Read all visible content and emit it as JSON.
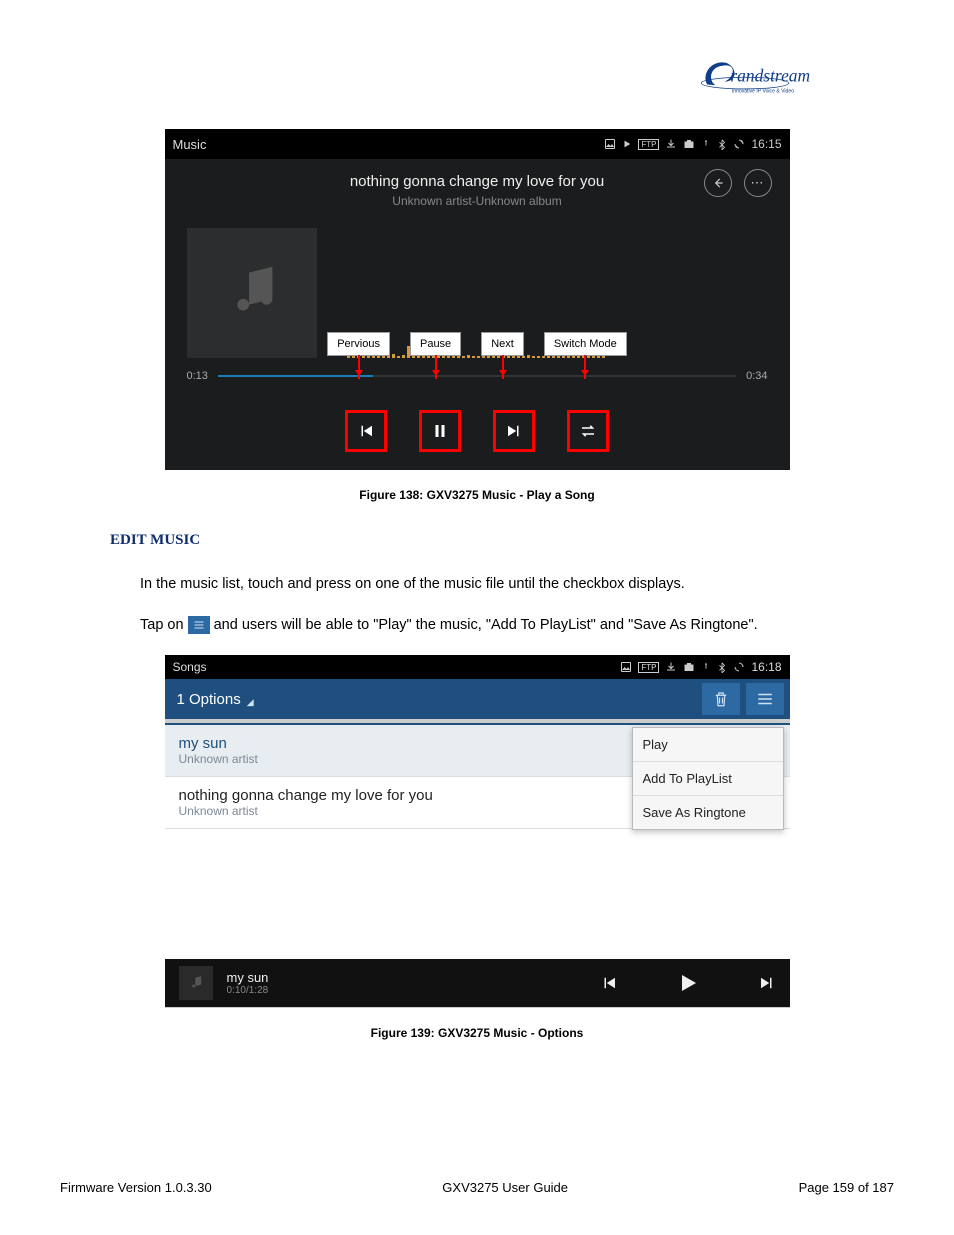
{
  "logo": {
    "brand": "Grandstream",
    "tagline": "Innovative IP Voice & Video"
  },
  "screenshot1": {
    "status": {
      "title": "Music",
      "time": "16:15"
    },
    "song": "nothing gonna change my love for you",
    "artist_album": "Unknown artist-Unknown album",
    "elapsed": "0:13",
    "total": "0:34",
    "labels": {
      "prev": "Pervious",
      "pause": "Pause",
      "next": "Next",
      "mode": "Switch Mode"
    }
  },
  "caption1": "Figure 138: GXV3275 Music - Play a Song",
  "section_heading": "EDIT MUSIC",
  "para1": "In the music list, touch and press on one of the music file until the checkbox displays.",
  "para2_pre": "Tap on ",
  "para2_post": " and users will be able to \"Play\" the music, \"Add To PlayList\" and \"Save As Ringtone\".",
  "screenshot2": {
    "status": {
      "title": "Songs",
      "time": "16:18"
    },
    "bar_label": "1 Options",
    "rows": [
      {
        "title": "my sun",
        "artist": "Unknown artist"
      },
      {
        "title": "nothing gonna change my love for you",
        "artist": "Unknown artist"
      }
    ],
    "popup": {
      "play": "Play",
      "add": "Add To PlayList",
      "save": "Save As Ringtone"
    },
    "footer": {
      "title": "my sun",
      "time": "0:10/1:28"
    }
  },
  "caption2": "Figure 139: GXV3275 Music - Options",
  "footer": {
    "left": "Firmware Version 1.0.3.30",
    "center": "GXV3275 User Guide",
    "right": "Page 159 of 187"
  }
}
